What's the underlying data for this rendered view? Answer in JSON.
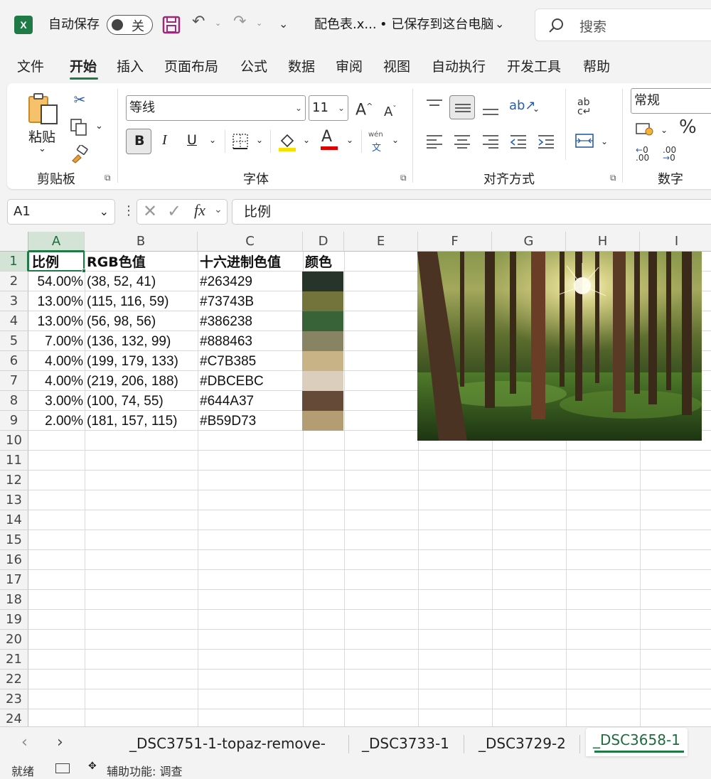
{
  "titlebar": {
    "autosave_label": "自动保存",
    "autosave_state": "关",
    "filename": "配色表.x...",
    "save_status": "• 已保存到这台电脑",
    "search_placeholder": "搜索"
  },
  "menu": {
    "items": [
      "文件",
      "开始",
      "插入",
      "页面布局",
      "公式",
      "数据",
      "审阅",
      "视图",
      "自动执行",
      "开发工具",
      "帮助"
    ],
    "active": "开始"
  },
  "ribbon": {
    "clipboard": {
      "paste": "粘贴",
      "group_label": "剪贴板"
    },
    "font": {
      "name": "等线",
      "size": "11",
      "bold": "B",
      "italic": "I",
      "underline": "U",
      "wen": "wén",
      "wen_char": "文",
      "group_label": "字体",
      "highlight_color": "#f5e000",
      "font_color": "#e00000"
    },
    "alignment": {
      "wrap": "ab",
      "group_label": "对齐方式"
    },
    "number": {
      "format": "常规",
      "percent": "%",
      "group_label": "数字"
    }
  },
  "formula_bar": {
    "name_box": "A1",
    "fx": "fx",
    "formula": "比例"
  },
  "sheet": {
    "columns": [
      "A",
      "B",
      "C",
      "D",
      "E",
      "F",
      "G",
      "H",
      "I"
    ],
    "rows": [
      "1",
      "2",
      "3",
      "4",
      "5",
      "6",
      "7",
      "8",
      "9",
      "10",
      "11",
      "12",
      "13",
      "14",
      "15",
      "16",
      "17",
      "18",
      "19",
      "20",
      "21",
      "22",
      "23",
      "24"
    ],
    "headers": {
      "ratio": "比例",
      "rgb": "RGB色值",
      "hex": "十六进制色值",
      "color": "颜色"
    },
    "data": [
      {
        "ratio": "54.00%",
        "rgb": "(38, 52, 41)",
        "hex": "#263429",
        "swatch": "#263429"
      },
      {
        "ratio": "13.00%",
        "rgb": "(115, 116, 59)",
        "hex": "#73743B",
        "swatch": "#73743B"
      },
      {
        "ratio": "13.00%",
        "rgb": "(56, 98, 56)",
        "hex": "#386238",
        "swatch": "#386238"
      },
      {
        "ratio": "7.00%",
        "rgb": "(136, 132, 99)",
        "hex": "#888463",
        "swatch": "#888463"
      },
      {
        "ratio": "4.00%",
        "rgb": "(199, 179, 133)",
        "hex": "#C7B385",
        "swatch": "#C7B385"
      },
      {
        "ratio": "4.00%",
        "rgb": "(219, 206, 188)",
        "hex": "#DBCEBC",
        "swatch": "#DBCEBC"
      },
      {
        "ratio": "3.00%",
        "rgb": "(100, 74, 55)",
        "hex": "#644A37",
        "swatch": "#644A37"
      },
      {
        "ratio": "2.00%",
        "rgb": "(181, 157, 115)",
        "hex": "#B59D73",
        "swatch": "#B59D73"
      }
    ],
    "image": "forest-photo"
  },
  "sheet_tabs": {
    "tabs": [
      "_DSC3751-1-topaz-remove-",
      "_DSC3733-1",
      "_DSC3729-2",
      "_DSC3658-1"
    ],
    "active": "_DSC3658-1"
  },
  "statusbar": {
    "ready": "就绪",
    "accessibility": "辅助功能: 调查"
  }
}
